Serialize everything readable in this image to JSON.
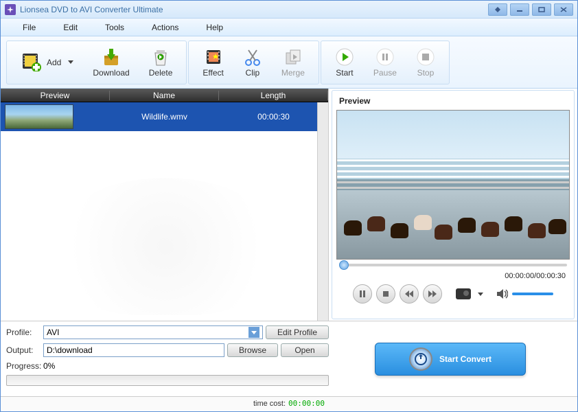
{
  "title": "Lionsea DVD to AVI Converter Ultimate",
  "menu": {
    "file": "File",
    "edit": "Edit",
    "tools": "Tools",
    "actions": "Actions",
    "help": "Help"
  },
  "toolbar": {
    "add": "Add",
    "download": "Download",
    "delete": "Delete",
    "effect": "Effect",
    "clip": "Clip",
    "merge": "Merge",
    "start": "Start",
    "pause": "Pause",
    "stop": "Stop"
  },
  "list": {
    "headers": {
      "preview": "Preview",
      "name": "Name",
      "length": "Length"
    },
    "rows": [
      {
        "name": "Wildlife.wmv",
        "length": "00:00:30"
      }
    ]
  },
  "preview": {
    "title": "Preview",
    "time": "00:00:00/00:00:30"
  },
  "profile": {
    "label": "Profile:",
    "value": "AVI",
    "edit": "Edit Profile"
  },
  "output": {
    "label": "Output:",
    "value": "D:\\download",
    "browse": "Browse",
    "open": "Open"
  },
  "progress": {
    "label": "Progress:",
    "value": "0%"
  },
  "convert": "Start Convert",
  "footer": {
    "label": "time cost:",
    "value": "00:00:00"
  }
}
